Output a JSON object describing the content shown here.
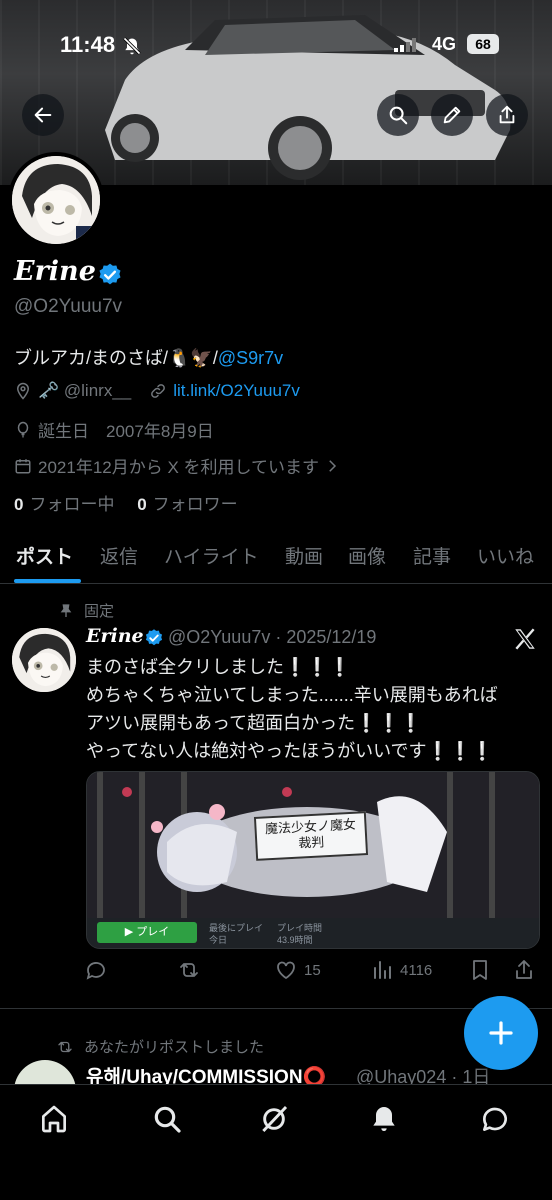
{
  "status_bar": {
    "time": "11:48",
    "network": "4G",
    "battery": "68"
  },
  "profile": {
    "display_name": "Erine",
    "handle": "@O2Yuuu7v",
    "bio_text": "ブルアカ/まのさば/🐧🦅/",
    "bio_link": "@S9r7v",
    "location_text": "🗝️ @linrx__",
    "website": "lit.link/O2Yuuu7v",
    "birthday": "誕生日　2007年8月9日",
    "joined": "2021年12月から X を利用しています",
    "following_count": "0",
    "following_label": "フォロー中",
    "followers_count": "0",
    "followers_label": "フォロワー"
  },
  "tabs": [
    {
      "label": "ポスト",
      "active": true
    },
    {
      "label": "返信"
    },
    {
      "label": "ハイライト"
    },
    {
      "label": "動画"
    },
    {
      "label": "画像"
    },
    {
      "label": "記事"
    },
    {
      "label": "いいね"
    }
  ],
  "pinned_post": {
    "pinned_label": "固定",
    "author_name": "Erine",
    "author_handle_date": "@O2Yuuu7v · 2025/12/19",
    "lines": [
      "まのさば全クリしました❕❕❕",
      "めちゃくちゃ泣いてしまった.......辛い展開もあれば",
      "アツい展開もあって超面白かった❕❕❕",
      "やってない人は絶対やったほうがいいです❕❕❕"
    ],
    "media": {
      "game_title": "魔法少女ノ魔女裁判",
      "play_label": "▶ プレイ",
      "last_played_label": "最後にプレイ",
      "last_played_value": "今日",
      "playtime_label": "プレイ時間",
      "playtime_value": "43.9時間"
    },
    "likes": "15",
    "views": "4116"
  },
  "second_post": {
    "repost_label": "あなたがリポストしました",
    "author_name": "유해/Uhay/COMMISSION⭕",
    "author_handle_date": "@Uhay024 · 1日"
  },
  "colors": {
    "accent": "#1d9bf0",
    "background": "#000000",
    "muted": "#71767b",
    "text": "#e7e9ea"
  }
}
